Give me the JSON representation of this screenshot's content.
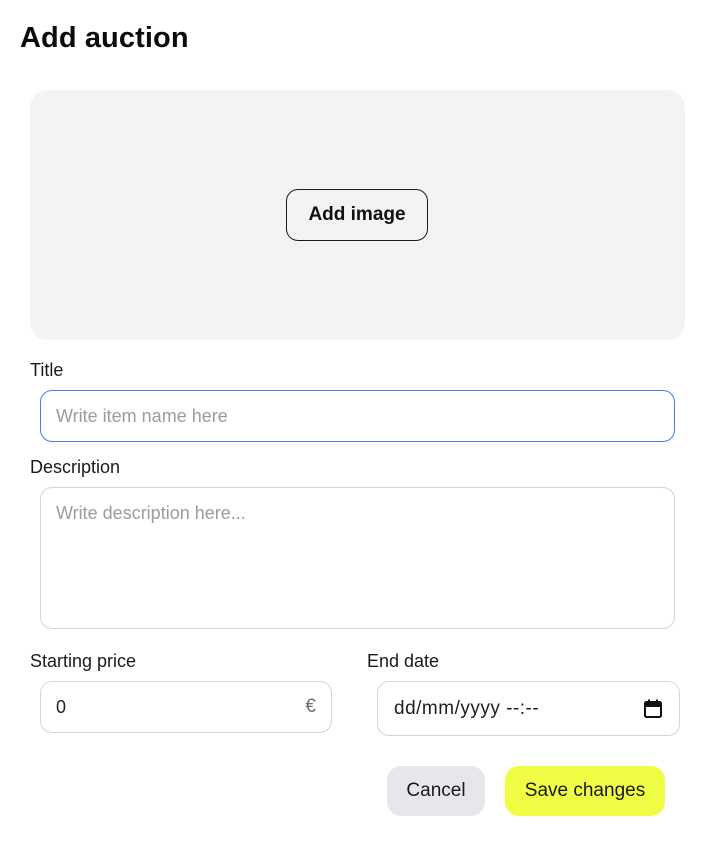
{
  "dialog": {
    "title": "Add auction"
  },
  "image_upload": {
    "button_label": "Add image"
  },
  "fields": {
    "title": {
      "label": "Title",
      "placeholder": "Write item name here",
      "value": ""
    },
    "description": {
      "label": "Description",
      "placeholder": "Write description here...",
      "value": ""
    },
    "starting_price": {
      "label": "Starting price",
      "value": "0",
      "currency": "€"
    },
    "end_date": {
      "label": "End date",
      "value": "dd/mm/yyyy --:--"
    }
  },
  "actions": {
    "cancel_label": "Cancel",
    "save_label": "Save changes"
  },
  "colors": {
    "accent_save": "#f0fd45",
    "focus_border": "#3b82f6",
    "image_area_bg": "#f2f3f5",
    "cancel_bg": "#e6e7ea"
  },
  "icons": {
    "date_picker": "calendar-icon"
  }
}
